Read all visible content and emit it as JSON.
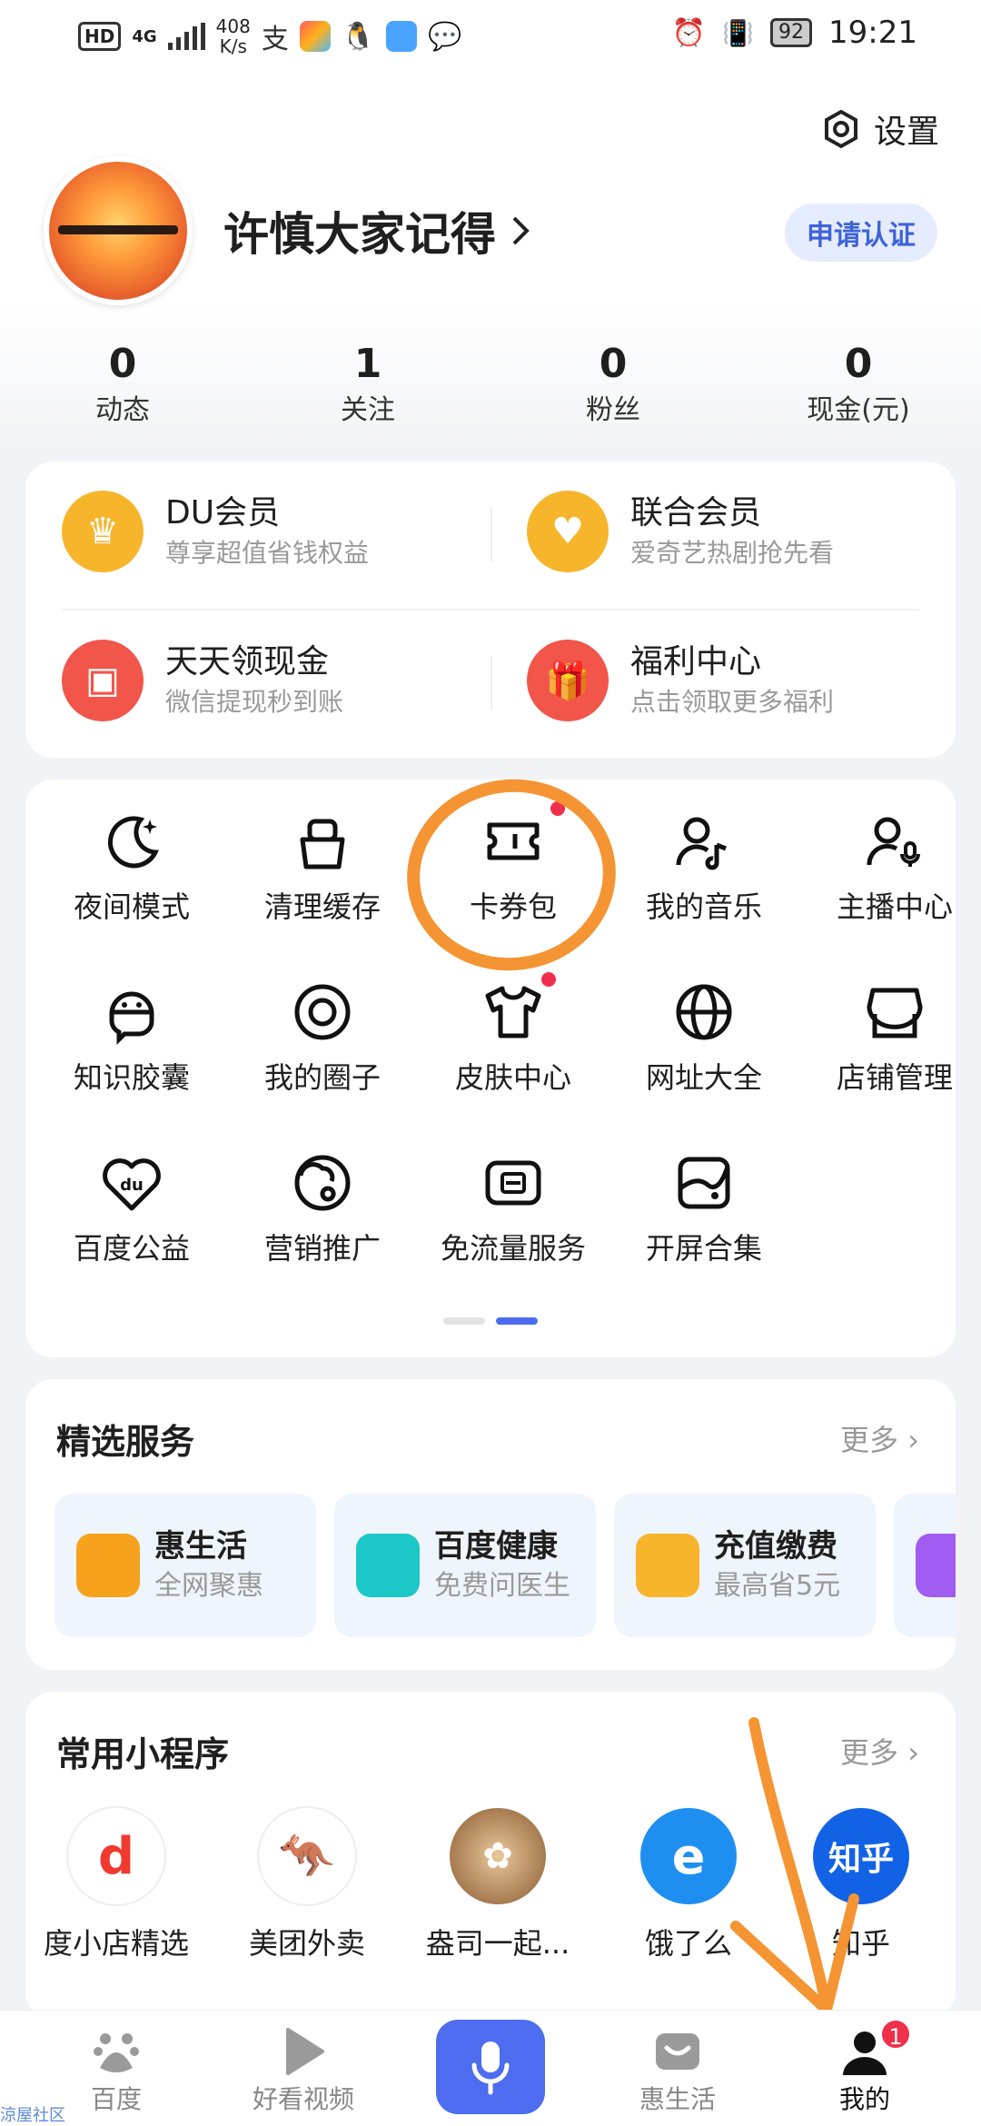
{
  "status_bar": {
    "hd": "HD",
    "network": "4G",
    "speed_value": "408",
    "speed_unit": "K/s",
    "battery": "92",
    "time": "19:21"
  },
  "header": {
    "settings_label": "设置",
    "username": "许慎大家记得",
    "certify_label": "申请认证"
  },
  "stats": [
    {
      "value": "0",
      "label": "动态"
    },
    {
      "value": "1",
      "label": "关注"
    },
    {
      "value": "0",
      "label": "粉丝"
    },
    {
      "value": "0",
      "label": "现金(元)"
    }
  ],
  "vip": [
    {
      "title": "DU会员",
      "sub": "尊享超值省钱权益",
      "icon": "crown-icon",
      "color": "#f7b52c"
    },
    {
      "title": "联合会员",
      "sub": "爱奇艺热剧抢先看",
      "icon": "badge-icon",
      "color": "#f7b52c"
    },
    {
      "title": "天天领现金",
      "sub": "微信提现秒到账",
      "icon": "wallet-icon",
      "color": "#f2554a"
    },
    {
      "title": "福利中心",
      "sub": "点击领取更多福利",
      "icon": "gift-icon",
      "color": "#f2554a"
    }
  ],
  "tools": [
    {
      "label": "夜间模式",
      "icon": "moon-icon"
    },
    {
      "label": "清理缓存",
      "icon": "trash-icon"
    },
    {
      "label": "卡券包",
      "icon": "ticket-icon"
    },
    {
      "label": "我的音乐",
      "icon": "music-icon"
    },
    {
      "label": "主播中心",
      "icon": "anchor-mic-icon"
    },
    {
      "label": "知识胶囊",
      "icon": "knowledge-icon"
    },
    {
      "label": "我的圈子",
      "icon": "circle-icon"
    },
    {
      "label": "皮肤中心",
      "icon": "shirt-icon"
    },
    {
      "label": "网址大全",
      "icon": "globe-icon"
    },
    {
      "label": "店铺管理",
      "icon": "shop-icon"
    },
    {
      "label": "百度公益",
      "icon": "heart-du-icon"
    },
    {
      "label": "营销推广",
      "icon": "marketing-icon"
    },
    {
      "label": "免流量服务",
      "icon": "data-free-icon"
    },
    {
      "label": "开屏合集",
      "icon": "splash-icon"
    }
  ],
  "services": {
    "title": "精选服务",
    "more": "更多",
    "items": [
      {
        "title": "惠生活",
        "sub": "全网聚惠",
        "icon": "hui-life-icon",
        "color": "#f7a21c"
      },
      {
        "title": "百度健康",
        "sub": "免费问医生",
        "icon": "health-icon",
        "color": "#1cc7c7"
      },
      {
        "title": "充值缴费",
        "sub": "最高省5元",
        "icon": "recharge-icon",
        "color": "#f7b52c"
      }
    ]
  },
  "miniapps": {
    "title": "常用小程序",
    "more": "更多",
    "items": [
      {
        "label": "度小店精选",
        "icon": "du-shop-icon",
        "glyph": "d",
        "color": "#fff",
        "fg": "#f03a2e"
      },
      {
        "label": "美团外卖",
        "icon": "meituan-icon",
        "glyph": "🦘",
        "color": "#fff",
        "fg": "#f5c518"
      },
      {
        "label": "盎司一起...",
        "icon": "ounce-icon",
        "glyph": "●",
        "color": "#b07a45",
        "fg": "#fff"
      },
      {
        "label": "饿了么",
        "icon": "eleme-icon",
        "glyph": "e",
        "color": "#1e8ff0",
        "fg": "#fff"
      },
      {
        "label": "知乎",
        "icon": "zhihu-icon",
        "glyph": "知乎",
        "color": "#1262e6",
        "fg": "#fff"
      }
    ]
  },
  "tabbar": [
    {
      "label": "百度",
      "icon": "baidu-paw-icon"
    },
    {
      "label": "好看视频",
      "icon": "play-icon"
    },
    {
      "label": "",
      "icon": "mic-icon"
    },
    {
      "label": "惠生活",
      "icon": "hui-icon"
    },
    {
      "label": "我的",
      "icon": "user-icon",
      "badge": "1"
    }
  ],
  "watermark": "涼屋社区",
  "colors": {
    "accent": "#4d6cf0",
    "annotation": "#f59433",
    "badge": "#f0304a"
  }
}
